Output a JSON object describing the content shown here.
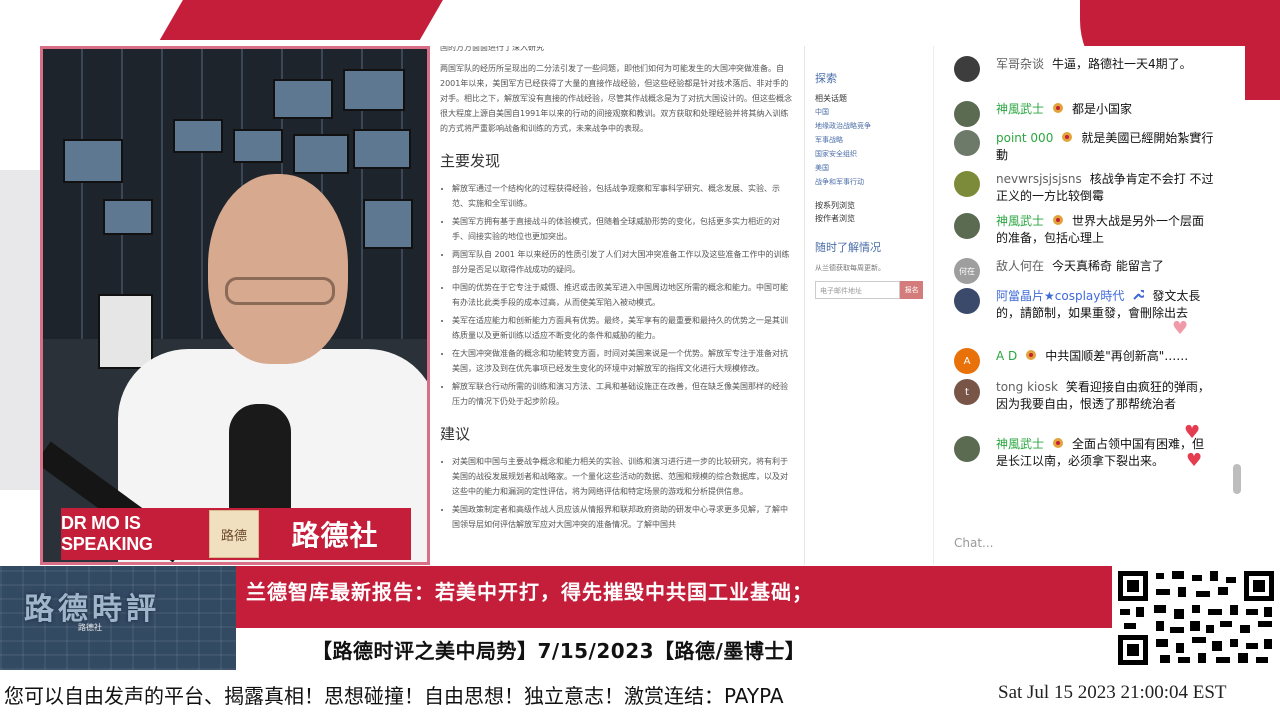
{
  "document": {
    "top_fragment": "国的方方面面进行了深入研究",
    "intro": "两国军队的经历所呈现出的二分法引发了一些问题，即他们如何为可能发生的大国冲突做准备。自2001年以来，美国军方已经获得了大量的直接作战经验，但这些经验都是针对技术落后、非对手的对手。相比之下，解放军没有直接的作战经验，尽管其作战概念是为了对抗大国设计的。但这些概念很大程度上源自美国自1991年以来的行动的间接观察和教训。双方获取和处理经验并将其纳入训练的方式将严重影响战备和训练的方式，未来战争中的表现。",
    "findings_heading": "主要发现",
    "findings": [
      "解放军通过一个结构化的过程获得经验，包括战争观察和军事科学研究、概念发展、实验、示范、实施和全军训练。",
      "美国军方拥有基于直接战斗的体验模式，但随着全球威胁形势的变化，包括更多实力相近的对手、间接实验的地位也更加突出。",
      "两国军队自 2001 年以来经历的性质引发了人们对大国冲突准备工作以及这些准备工作中的训练部分是否足以取得作战成功的疑问。",
      "中国的优势在于它专注于威慑、推迟或击败美军进入中国周边地区所需的概念和能力。中国可能有办法比此类手段的成本过高，从而使美军陷入被动模式。",
      "美军在适应能力和创新能力方面具有优势。最终，美军享有的最重要和最持久的优势之一是其训练质量以及更新训练以适应不断变化的条件和威胁的能力。",
      "在大国冲突做准备的概念和功能转变方面，时间对美国来说是一个优势。解放军专注于准备对抗美国，这涉及到在优先事项已经发生变化的环境中对解放军的指挥文化进行大规模修改。",
      "解放军联合行动所需的训练和演习方法、工具和基础设施正在改善，但在缺乏像美国那样的经验压力的情况下仍处于起步阶段。"
    ],
    "recommendations_heading": "建议",
    "recommendations": [
      "对美国和中国与主要战争概念和能力相关的实验、训练和演习进行进一步的比较研究，将有利于美国的战役发展规划者和战略家。一个量化这些活动的数据、范围和规模的综合数据库，以及对这些中的能力和漏洞的定性评估，将为网络评估和特定场景的游戏和分析提供信息。",
      "美国政策制定者和高级作战人员应该从情报界和联邦政府资助的研发中心寻求更多见解，了解中国领导层如何评估解放军应对大国冲突的准备情况。了解中国共"
    ]
  },
  "sidebar": {
    "explore_title": "探索",
    "related_label": "相关话题",
    "topics": [
      "中国",
      "地缘政治战略竞争",
      "军事战略",
      "国家安全组织",
      "美国",
      "战争和军事行动"
    ],
    "browse_series": "按系列浏览",
    "browse_author": "按作者浏览",
    "updates_title": "随时了解情况",
    "updates_desc": "从兰德获取每周更新。",
    "email_placeholder": "电子邮件地址",
    "signup_label": "报名"
  },
  "chat": {
    "messages": [
      {
        "name": "军哥杂谈",
        "text": "牛逼，路德社一天4期了。",
        "avatar_color": "#3d3d3d",
        "avatar_text": "",
        "role": "plain"
      },
      {
        "name": "神風武士",
        "text": "都是小国家",
        "avatar_color": "#5a6b52",
        "avatar_text": "",
        "role": "member"
      },
      {
        "name": "point 000",
        "text": "就是美國已經開始紮實行動",
        "avatar_color": "#6d7a6a",
        "avatar_text": "",
        "role": "member"
      },
      {
        "name": "nevwrsjsjsjsns",
        "text": "核战争肯定不会打 不过正义的一方比较倒霉",
        "avatar_color": "#7c8b3a",
        "avatar_text": "",
        "role": "plain"
      },
      {
        "name": "神風武士",
        "text": "世界大战是另外一个层面的准备，包括心理上",
        "avatar_color": "#5a6b52",
        "avatar_text": "",
        "role": "member"
      },
      {
        "name": "敌人何在",
        "text": "今天真稀奇 能留言了",
        "avatar_color": "#9e9e9e",
        "avatar_text": "何在",
        "role": "plain"
      },
      {
        "name": "阿當晶片★cosplay時代",
        "text": "發文太長的，請節制，如果重發，會刪除出去",
        "avatar_color": "#3b4a6b",
        "avatar_text": "",
        "role": "mod"
      },
      {
        "name": "A D",
        "text": "中共国顺差\"再创新高\"……",
        "avatar_color": "#e8710a",
        "avatar_text": "A",
        "role": "member"
      },
      {
        "name": "tong kiosk",
        "text": "笑看迎接自由疯狂的弹雨，因为我要自由，恨透了那帮统治者",
        "avatar_color": "#795548",
        "avatar_text": "t",
        "role": "plain"
      },
      {
        "name": "神風武士",
        "text": "全面占领中国有困难，但是长江以南，必须拿下裂出来。",
        "avatar_color": "#5a6b52",
        "avatar_text": "",
        "role": "member"
      }
    ],
    "input_placeholder": "Chat..."
  },
  "overlay": {
    "badge_left": "DR MO IS SPEAKING",
    "badge_logo": "路德",
    "badge_right": "路德社",
    "brand_title": "路德時評",
    "brand_sub": "路德社",
    "headline": "兰德智库最新报告：若美中开打，得先摧毁中共国工业基础；",
    "subline": "【路德时评之美中局势】7/15/2023【路德/墨博士】",
    "ticker": "您可以自由发声的平台、揭露真相！思想碰撞！自由思想！独立意志！激赏连结：PAYPA",
    "datetime": "Sat Jul 15 2023 21:00:04 EST"
  },
  "colors": {
    "brand_red": "#c41e3a",
    "member_green": "#2ba640",
    "mod_blue": "#3f6ad8",
    "link_blue": "#4a6da7"
  }
}
